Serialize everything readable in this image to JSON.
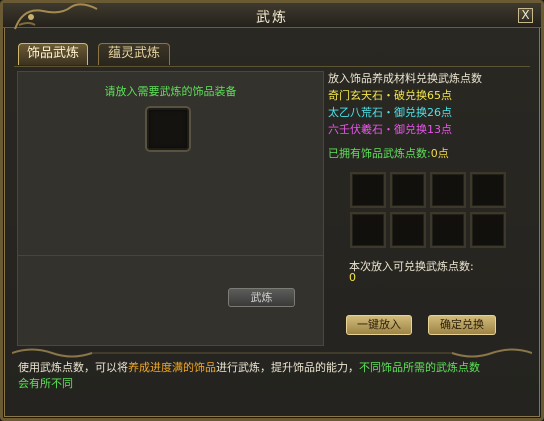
{
  "window": {
    "title": "武炼",
    "close_label": "X"
  },
  "tabs": [
    {
      "label": "饰品武炼",
      "active": true
    },
    {
      "label": "蕴灵武炼",
      "active": false
    }
  ],
  "left": {
    "hint": "请放入需要武炼的饰品装备",
    "refine_button": "武炼"
  },
  "right": {
    "title": "放入饰品养成材料兑换武炼点数",
    "materials": [
      {
        "text": "奇门玄天石・破兑换65点",
        "color": "#f3e64a"
      },
      {
        "text": "太乙八荒石・御兑换26点",
        "color": "#4de3e8"
      },
      {
        "text": "六壬伏羲石・御兑换13点",
        "color": "#e657e8"
      }
    ],
    "owned_label": "已拥有饰品武炼点数:",
    "owned_value": "0点",
    "exchange_label": "本次放入可兑换武炼点数:",
    "exchange_value": "0",
    "quick_button": "一键放入",
    "confirm_button": "确定兑换"
  },
  "description": {
    "part1": "使用武炼点数，可以将",
    "part2": "养成进度满的饰品",
    "part3": "进行武炼，提升饰品的能力，",
    "part4": "不同饰品所需的武炼点数",
    "part5": "会有所不同"
  },
  "colors": {
    "green_text": "#5ee15a",
    "yellow_text": "#f3e64a",
    "cyan_text": "#4de3e8",
    "magenta_text": "#e657e8",
    "orange_text": "#f3a826",
    "gold_button": "#c9b06d"
  }
}
